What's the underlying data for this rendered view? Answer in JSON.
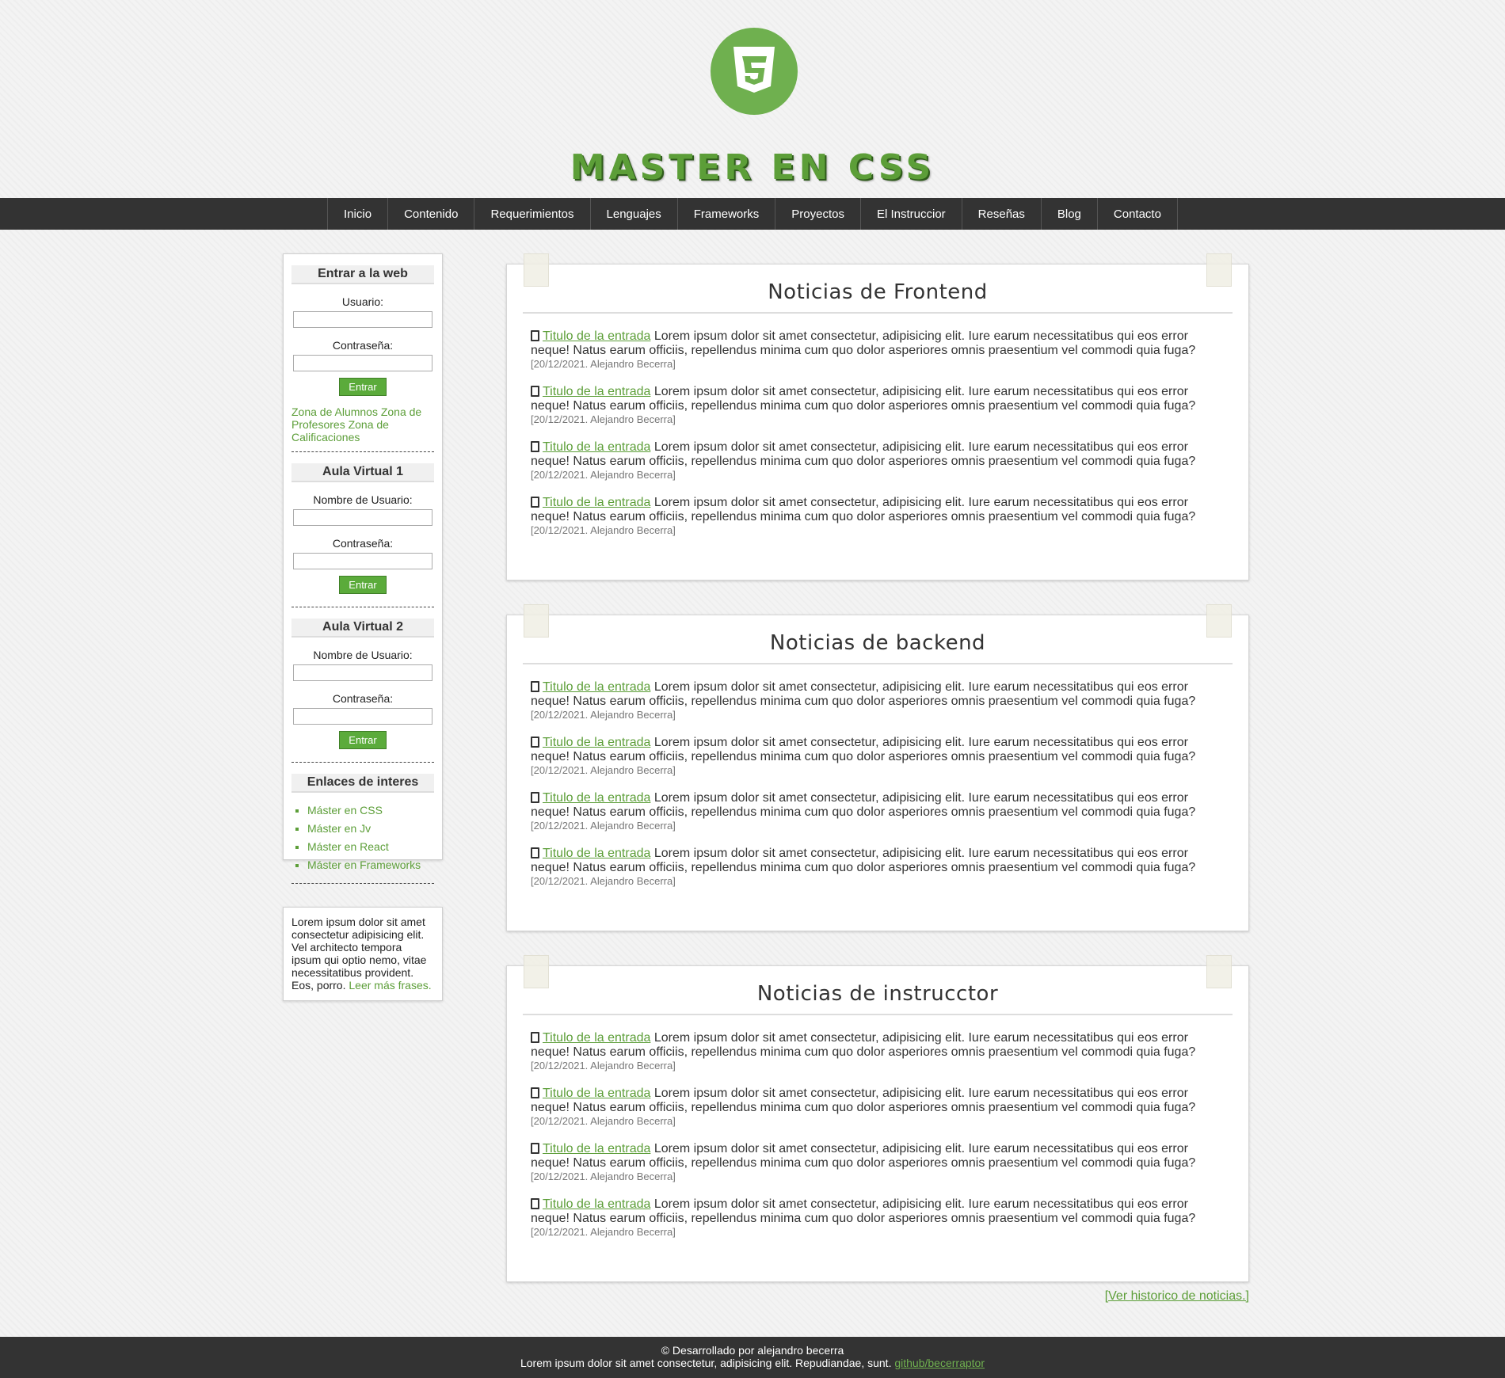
{
  "header": {
    "title": "MASTER EN CSS",
    "logo_icon": "css3-logo-icon",
    "accent_color": "#5c9e38"
  },
  "nav": {
    "items": [
      "Inicio",
      "Contenido",
      "Requerimientos",
      "Lenguajes",
      "Frameworks",
      "Proyectos",
      "El Instruccior",
      "Reseñas",
      "Blog",
      "Contacto"
    ]
  },
  "sidebar": {
    "login": {
      "title": "Entrar a la web",
      "user_label": "Usuario:",
      "password_label": "Contraseña:",
      "button": "Entrar",
      "links": "Zona de Alumnos Zona de Profesores Zona de Calificaciones"
    },
    "aula1": {
      "title": "Aula Virtual 1",
      "user_label": "Nombre de Usuario:",
      "password_label": "Contraseña:",
      "button": "Entrar"
    },
    "aula2": {
      "title": "Aula Virtual 2",
      "user_label": "Nombre de Usuario:",
      "password_label": "Contraseña:",
      "button": "Entrar"
    },
    "links": {
      "title": "Enlaces de interes",
      "items": [
        "Máster en CSS",
        "Máster en Jv",
        "Máster en React",
        "Máster en Frameworks"
      ]
    }
  },
  "quote": {
    "text": "Lorem ipsum dolor sit amet consectetur adipisicing elit. Vel architecto tempora ipsum qui optio nemo, vitae necessitatibus provident. Eos, porro.",
    "link": "Leer más frases."
  },
  "news": [
    {
      "title": "Noticias de Frontend",
      "entries": [
        {
          "link": "Titulo de la entrada",
          "text": "Lorem ipsum dolor sit amet consectetur, adipisicing elit. Iure earum necessitatibus qui eos error neque! Natus earum officiis, repellendus minima cum quo dolor asperiores omnis praesentium vel commodi quia fuga?",
          "meta": "[20/12/2021. Alejandro Becerra]"
        },
        {
          "link": "Titulo de la entrada",
          "text": "Lorem ipsum dolor sit amet consectetur, adipisicing elit. Iure earum necessitatibus qui eos error neque! Natus earum officiis, repellendus minima cum quo dolor asperiores omnis praesentium vel commodi quia fuga?",
          "meta": "[20/12/2021. Alejandro Becerra]"
        },
        {
          "link": "Titulo de la entrada",
          "text": "Lorem ipsum dolor sit amet consectetur, adipisicing elit. Iure earum necessitatibus qui eos error neque! Natus earum officiis, repellendus minima cum quo dolor asperiores omnis praesentium vel commodi quia fuga?",
          "meta": "[20/12/2021. Alejandro Becerra]"
        },
        {
          "link": "Titulo de la entrada",
          "text": "Lorem ipsum dolor sit amet consectetur, adipisicing elit. Iure earum necessitatibus qui eos error neque! Natus earum officiis, repellendus minima cum quo dolor asperiores omnis praesentium vel commodi quia fuga?",
          "meta": "[20/12/2021. Alejandro Becerra]"
        }
      ]
    },
    {
      "title": "Noticias de backend",
      "entries": [
        {
          "link": "Titulo de la entrada",
          "text": "Lorem ipsum dolor sit amet consectetur, adipisicing elit. Iure earum necessitatibus qui eos error neque! Natus earum officiis, repellendus minima cum quo dolor asperiores omnis praesentium vel commodi quia fuga?",
          "meta": "[20/12/2021. Alejandro Becerra]"
        },
        {
          "link": "Titulo de la entrada",
          "text": "Lorem ipsum dolor sit amet consectetur, adipisicing elit. Iure earum necessitatibus qui eos error neque! Natus earum officiis, repellendus minima cum quo dolor asperiores omnis praesentium vel commodi quia fuga?",
          "meta": "[20/12/2021. Alejandro Becerra]"
        },
        {
          "link": "Titulo de la entrada",
          "text": "Lorem ipsum dolor sit amet consectetur, adipisicing elit. Iure earum necessitatibus qui eos error neque! Natus earum officiis, repellendus minima cum quo dolor asperiores omnis praesentium vel commodi quia fuga?",
          "meta": "[20/12/2021. Alejandro Becerra]"
        },
        {
          "link": "Titulo de la entrada",
          "text": "Lorem ipsum dolor sit amet consectetur, adipisicing elit. Iure earum necessitatibus qui eos error neque! Natus earum officiis, repellendus minima cum quo dolor asperiores omnis praesentium vel commodi quia fuga?",
          "meta": "[20/12/2021. Alejandro Becerra]"
        }
      ]
    },
    {
      "title": "Noticias de instrucctor",
      "entries": [
        {
          "link": "Titulo de la entrada",
          "text": "Lorem ipsum dolor sit amet consectetur, adipisicing elit. Iure earum necessitatibus qui eos error neque! Natus earum officiis, repellendus minima cum quo dolor asperiores omnis praesentium vel commodi quia fuga?",
          "meta": "[20/12/2021. Alejandro Becerra]"
        },
        {
          "link": "Titulo de la entrada",
          "text": "Lorem ipsum dolor sit amet consectetur, adipisicing elit. Iure earum necessitatibus qui eos error neque! Natus earum officiis, repellendus minima cum quo dolor asperiores omnis praesentium vel commodi quia fuga?",
          "meta": "[20/12/2021. Alejandro Becerra]"
        },
        {
          "link": "Titulo de la entrada",
          "text": "Lorem ipsum dolor sit amet consectetur, adipisicing elit. Iure earum necessitatibus qui eos error neque! Natus earum officiis, repellendus minima cum quo dolor asperiores omnis praesentium vel commodi quia fuga?",
          "meta": "[20/12/2021. Alejandro Becerra]"
        },
        {
          "link": "Titulo de la entrada",
          "text": "Lorem ipsum dolor sit amet consectetur, adipisicing elit. Iure earum necessitatibus qui eos error neque! Natus earum officiis, repellendus minima cum quo dolor asperiores omnis praesentium vel commodi quia fuga?",
          "meta": "[20/12/2021. Alejandro Becerra]"
        }
      ]
    }
  ],
  "history_link": "[Ver historico de noticias.]",
  "footer": {
    "credit": "© Desarrollado por alejandro becerra",
    "text": "Lorem ipsum dolor sit amet consectetur, adipisicing elit. Repudiandae, sunt.",
    "link": "github/becerraptor"
  }
}
